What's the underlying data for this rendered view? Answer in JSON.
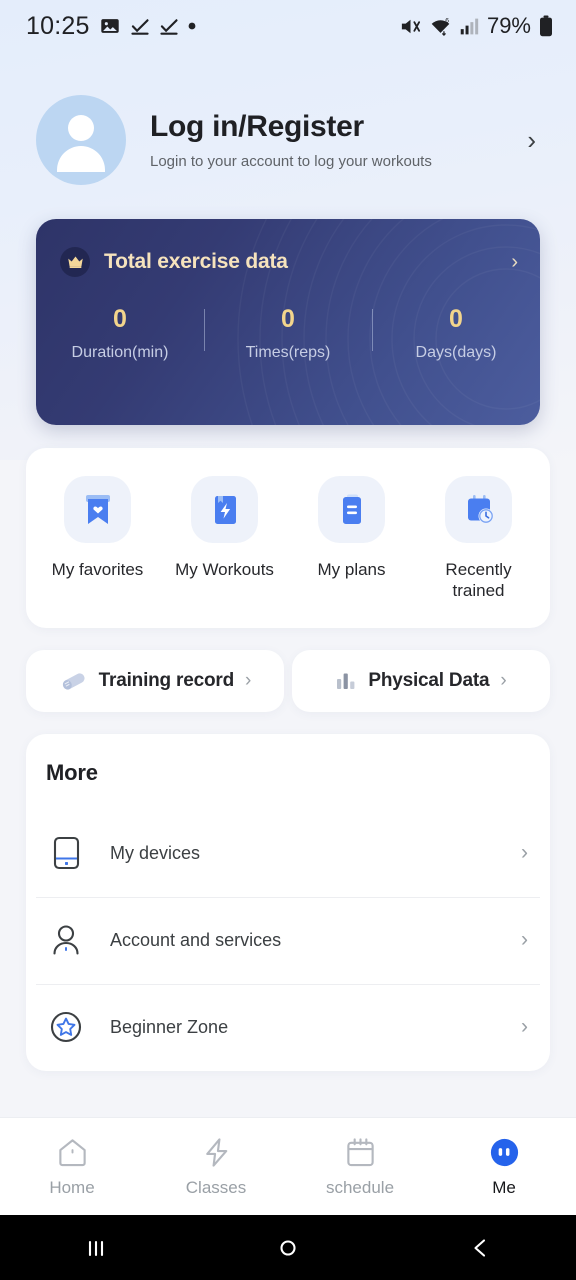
{
  "status_bar": {
    "time": "10:25",
    "icons_left": [
      "image-icon",
      "checkmark-icon",
      "checkmark-icon",
      "dot-icon"
    ],
    "icons_right": [
      "mute-icon",
      "wifi-icon",
      "signal-icon"
    ],
    "battery": "79%"
  },
  "profile": {
    "title": "Log in/Register",
    "subtitle": "Login to your account to log your workouts",
    "chevron": "›",
    "avatar_icon": "person-avatar-icon"
  },
  "total_card": {
    "title": "Total exercise data",
    "crown_icon": "crown-icon",
    "chevron": "›",
    "stats": [
      {
        "value": "0",
        "label": "Duration(min)"
      },
      {
        "value": "0",
        "label": "Times(reps)"
      },
      {
        "value": "0",
        "label": "Days(days)"
      }
    ]
  },
  "quick_actions": [
    {
      "label": "My favorites",
      "icon": "bookmark-heart-icon"
    },
    {
      "label": "My Workouts",
      "icon": "book-lightning-icon"
    },
    {
      "label": "My plans",
      "icon": "clipboard-icon"
    },
    {
      "label": "Recently trained",
      "icon": "calendar-clock-icon"
    }
  ],
  "pills": [
    {
      "label": "Training record",
      "icon": "eraser-icon",
      "chevron": "›"
    },
    {
      "label": "Physical Data",
      "icon": "bar-chart-icon",
      "chevron": "›"
    }
  ],
  "more": {
    "title": "More",
    "items": [
      {
        "label": "My devices",
        "icon": "device-icon",
        "chevron": "›"
      },
      {
        "label": "Account and services",
        "icon": "account-person-icon",
        "chevron": "›"
      },
      {
        "label": "Beginner Zone",
        "icon": "star-circle-icon",
        "chevron": "›"
      }
    ]
  },
  "bottom_nav": {
    "items": [
      {
        "label": "Home",
        "icon": "home-icon",
        "active": false
      },
      {
        "label": "Classes",
        "icon": "lightning-icon",
        "active": false
      },
      {
        "label": "schedule",
        "icon": "calendar-icon",
        "active": false
      },
      {
        "label": "Me",
        "icon": "me-avatar-icon",
        "active": true
      }
    ]
  },
  "system_bar": {
    "recents_icon": "recents-icon",
    "home_icon": "home-circle-icon",
    "back_icon": "back-icon"
  },
  "colors": {
    "background_top": "#e4edfb",
    "background": "#f4f5f9",
    "card_dark_from": "#2e3468",
    "card_dark_to": "#4c5d9e",
    "gold": "#f3d58c",
    "accent_blue": "#2563eb",
    "icon_blue": "#4a7ef0"
  }
}
